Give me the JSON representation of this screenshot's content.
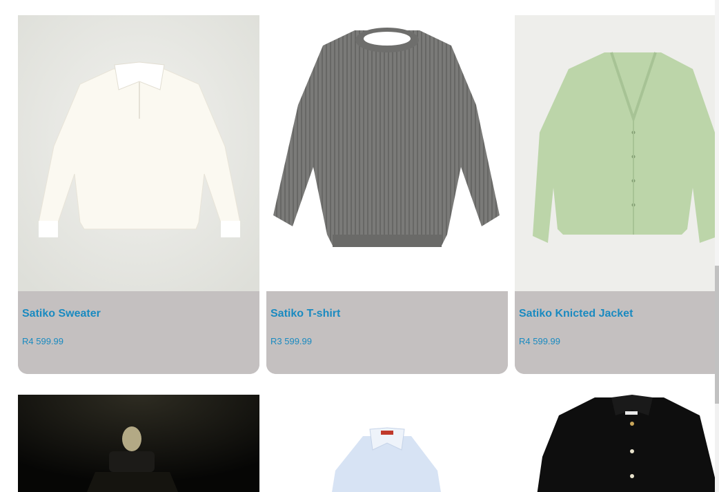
{
  "products": [
    {
      "name": "Satiko Sweater",
      "price": "R4 599.99",
      "image_icon": "white-polo-sweater-image"
    },
    {
      "name": "Satiko T-shirt",
      "price": "R3 599.99",
      "image_icon": "grey-knit-sweater-image"
    },
    {
      "name": "Satiko Knicted Jacket",
      "price": "R4 599.99",
      "image_icon": "green-cardigan-image"
    }
  ],
  "next_row": [
    {
      "image_icon": "dark-mannequin-image"
    },
    {
      "image_icon": "white-shirt-image"
    },
    {
      "image_icon": "black-shirt-image"
    }
  ],
  "colors": {
    "card_bg": "#c4c0c0",
    "link_blue": "#1a8ac0"
  }
}
